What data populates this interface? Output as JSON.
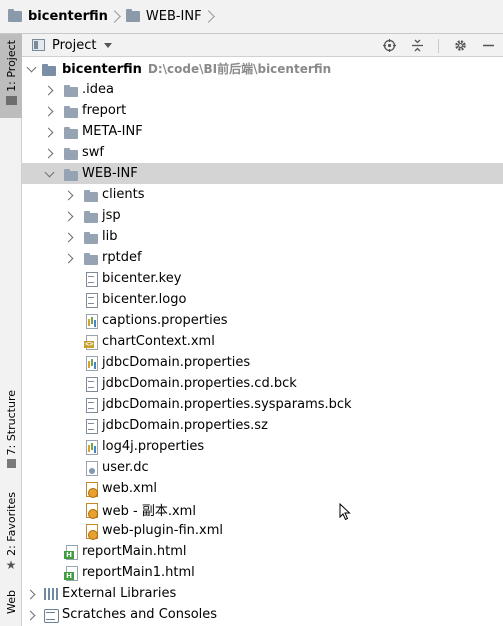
{
  "breadcrumb": {
    "items": [
      {
        "label": "bicenterfin",
        "bold": true
      },
      {
        "label": "WEB-INF",
        "bold": false
      }
    ]
  },
  "left_strip": {
    "project_tab": "1: Project",
    "structure_tab": "7: Structure",
    "favorites_tab": "2: Favorites",
    "web_tab": "Web"
  },
  "panel": {
    "title": "Project"
  },
  "tree": {
    "root": {
      "label": "bicenterfin",
      "path": "D:\\code\\BI前后端\\bicenterfin"
    },
    "rows": [
      {
        "label": ".idea"
      },
      {
        "label": "freport"
      },
      {
        "label": "META-INF"
      },
      {
        "label": "swf"
      },
      {
        "label": "WEB-INF"
      },
      {
        "label": "clients"
      },
      {
        "label": "jsp"
      },
      {
        "label": "lib"
      },
      {
        "label": "rptdef"
      },
      {
        "label": "bicenter.key"
      },
      {
        "label": "bicenter.logo"
      },
      {
        "label": "captions.properties"
      },
      {
        "label": "chartContext.xml"
      },
      {
        "label": "jdbcDomain.properties"
      },
      {
        "label": "jdbcDomain.properties.cd.bck"
      },
      {
        "label": "jdbcDomain.properties.sysparams.bck"
      },
      {
        "label": "jdbcDomain.properties.sz"
      },
      {
        "label": "log4j.properties"
      },
      {
        "label": "user.dc"
      },
      {
        "label": "web.xml"
      },
      {
        "label": "web - 副本.xml"
      },
      {
        "label": "web-plugin-fin.xml"
      },
      {
        "label": "reportMain.html"
      },
      {
        "label": "reportMain1.html"
      },
      {
        "label": "External Libraries"
      },
      {
        "label": "Scratches and Consoles"
      }
    ]
  }
}
